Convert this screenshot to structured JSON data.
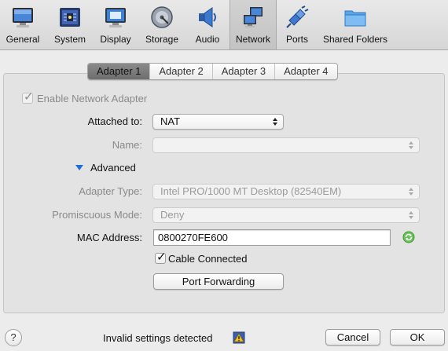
{
  "toolbar": {
    "items": [
      {
        "label": "General",
        "icon": "general-icon"
      },
      {
        "label": "System",
        "icon": "system-chip-icon"
      },
      {
        "label": "Display",
        "icon": "display-monitor-icon"
      },
      {
        "label": "Storage",
        "icon": "storage-disk-icon"
      },
      {
        "label": "Audio",
        "icon": "audio-speaker-icon"
      },
      {
        "label": "Network",
        "icon": "network-icon"
      },
      {
        "label": "Ports",
        "icon": "ports-plug-icon"
      },
      {
        "label": "Shared Folders",
        "icon": "folder-icon"
      }
    ],
    "active": "Network"
  },
  "tabs": [
    "Adapter 1",
    "Adapter 2",
    "Adapter 3",
    "Adapter 4"
  ],
  "active_tab": "Adapter 1",
  "form": {
    "enable_label": "Enable Network Adapter",
    "enable_checked": true,
    "attached_label": "Attached to:",
    "attached_value": "NAT",
    "name_label": "Name:",
    "name_value": "",
    "advanced_label": "Advanced",
    "adapter_type_label": "Adapter Type:",
    "adapter_type_value": "Intel PRO/1000 MT Desktop (82540EM)",
    "promiscuous_label": "Promiscuous Mode:",
    "promiscuous_value": "Deny",
    "mac_label": "MAC Address:",
    "mac_value": "0800270FE600",
    "cable_label": "Cable Connected",
    "cable_checked": true,
    "port_forwarding_label": "Port Forwarding"
  },
  "footer": {
    "help_label": "?",
    "status_text": "Invalid settings detected",
    "cancel_label": "Cancel",
    "ok_label": "OK"
  },
  "colors": {
    "accent_blue": "#1f6fd6",
    "refresh_green": "#3c9b2c",
    "warning_yellow": "#f3c21b"
  }
}
